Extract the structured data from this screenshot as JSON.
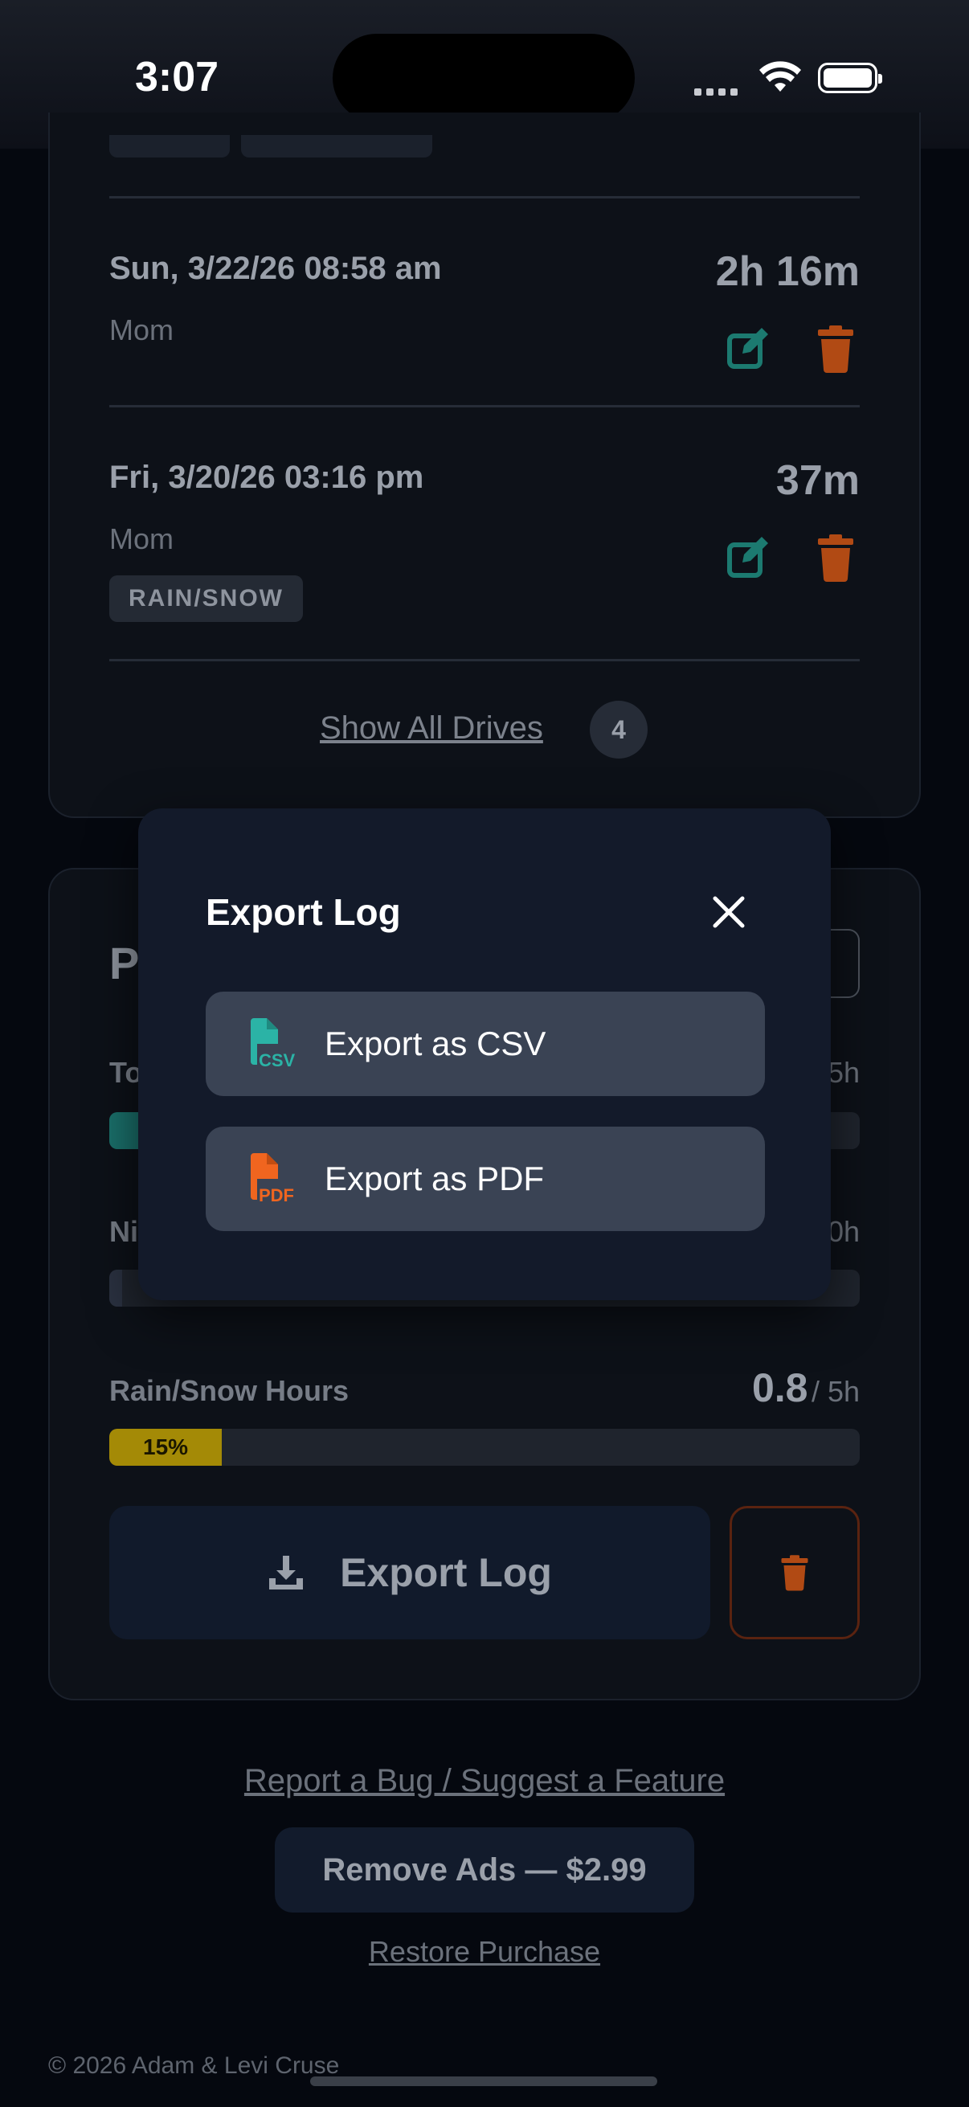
{
  "status_bar": {
    "time": "3:07"
  },
  "drives": [
    {
      "date": "Sun, 3/22/26 08:58 am",
      "driver": "Mom",
      "duration": "2h 16m",
      "tags": []
    },
    {
      "date": "Fri, 3/20/26 03:16 pm",
      "driver": "Mom",
      "duration": "37m",
      "tags": [
        "RAIN/SNOW"
      ]
    }
  ],
  "show_all": {
    "label": "Show All Drives",
    "count": "4"
  },
  "progress": {
    "title_partial": "P",
    "total_partial": "To",
    "total_goal_partial": "5h",
    "night_partial": "Ni",
    "night_goal_partial": "0h",
    "rain": {
      "label": "Rain/Snow Hours",
      "value": "0.8",
      "goal": "/ 5h",
      "percent_label": "15%",
      "fraction": 0.15
    },
    "colors": {
      "rain_fill": "#a48a06",
      "total_fill": "#1a6f6a",
      "edit_icon": "#1c7a70",
      "delete_icon": "#b14a14"
    }
  },
  "actions": {
    "export_label": "Export Log"
  },
  "footer": {
    "report_link": "Report a Bug / Suggest a Feature",
    "remove_ads": "Remove Ads — $2.99",
    "restore": "Restore Purchase",
    "copyright": "© 2026 Adam & Levi Cruse"
  },
  "modal": {
    "title": "Export Log",
    "options": [
      {
        "label": "Export as CSV",
        "icon": "csv-file-icon",
        "badge": "CSV",
        "color": "#2bb3a6"
      },
      {
        "label": "Export as PDF",
        "icon": "pdf-file-icon",
        "badge": "PDF",
        "color": "#f0651f"
      }
    ]
  }
}
